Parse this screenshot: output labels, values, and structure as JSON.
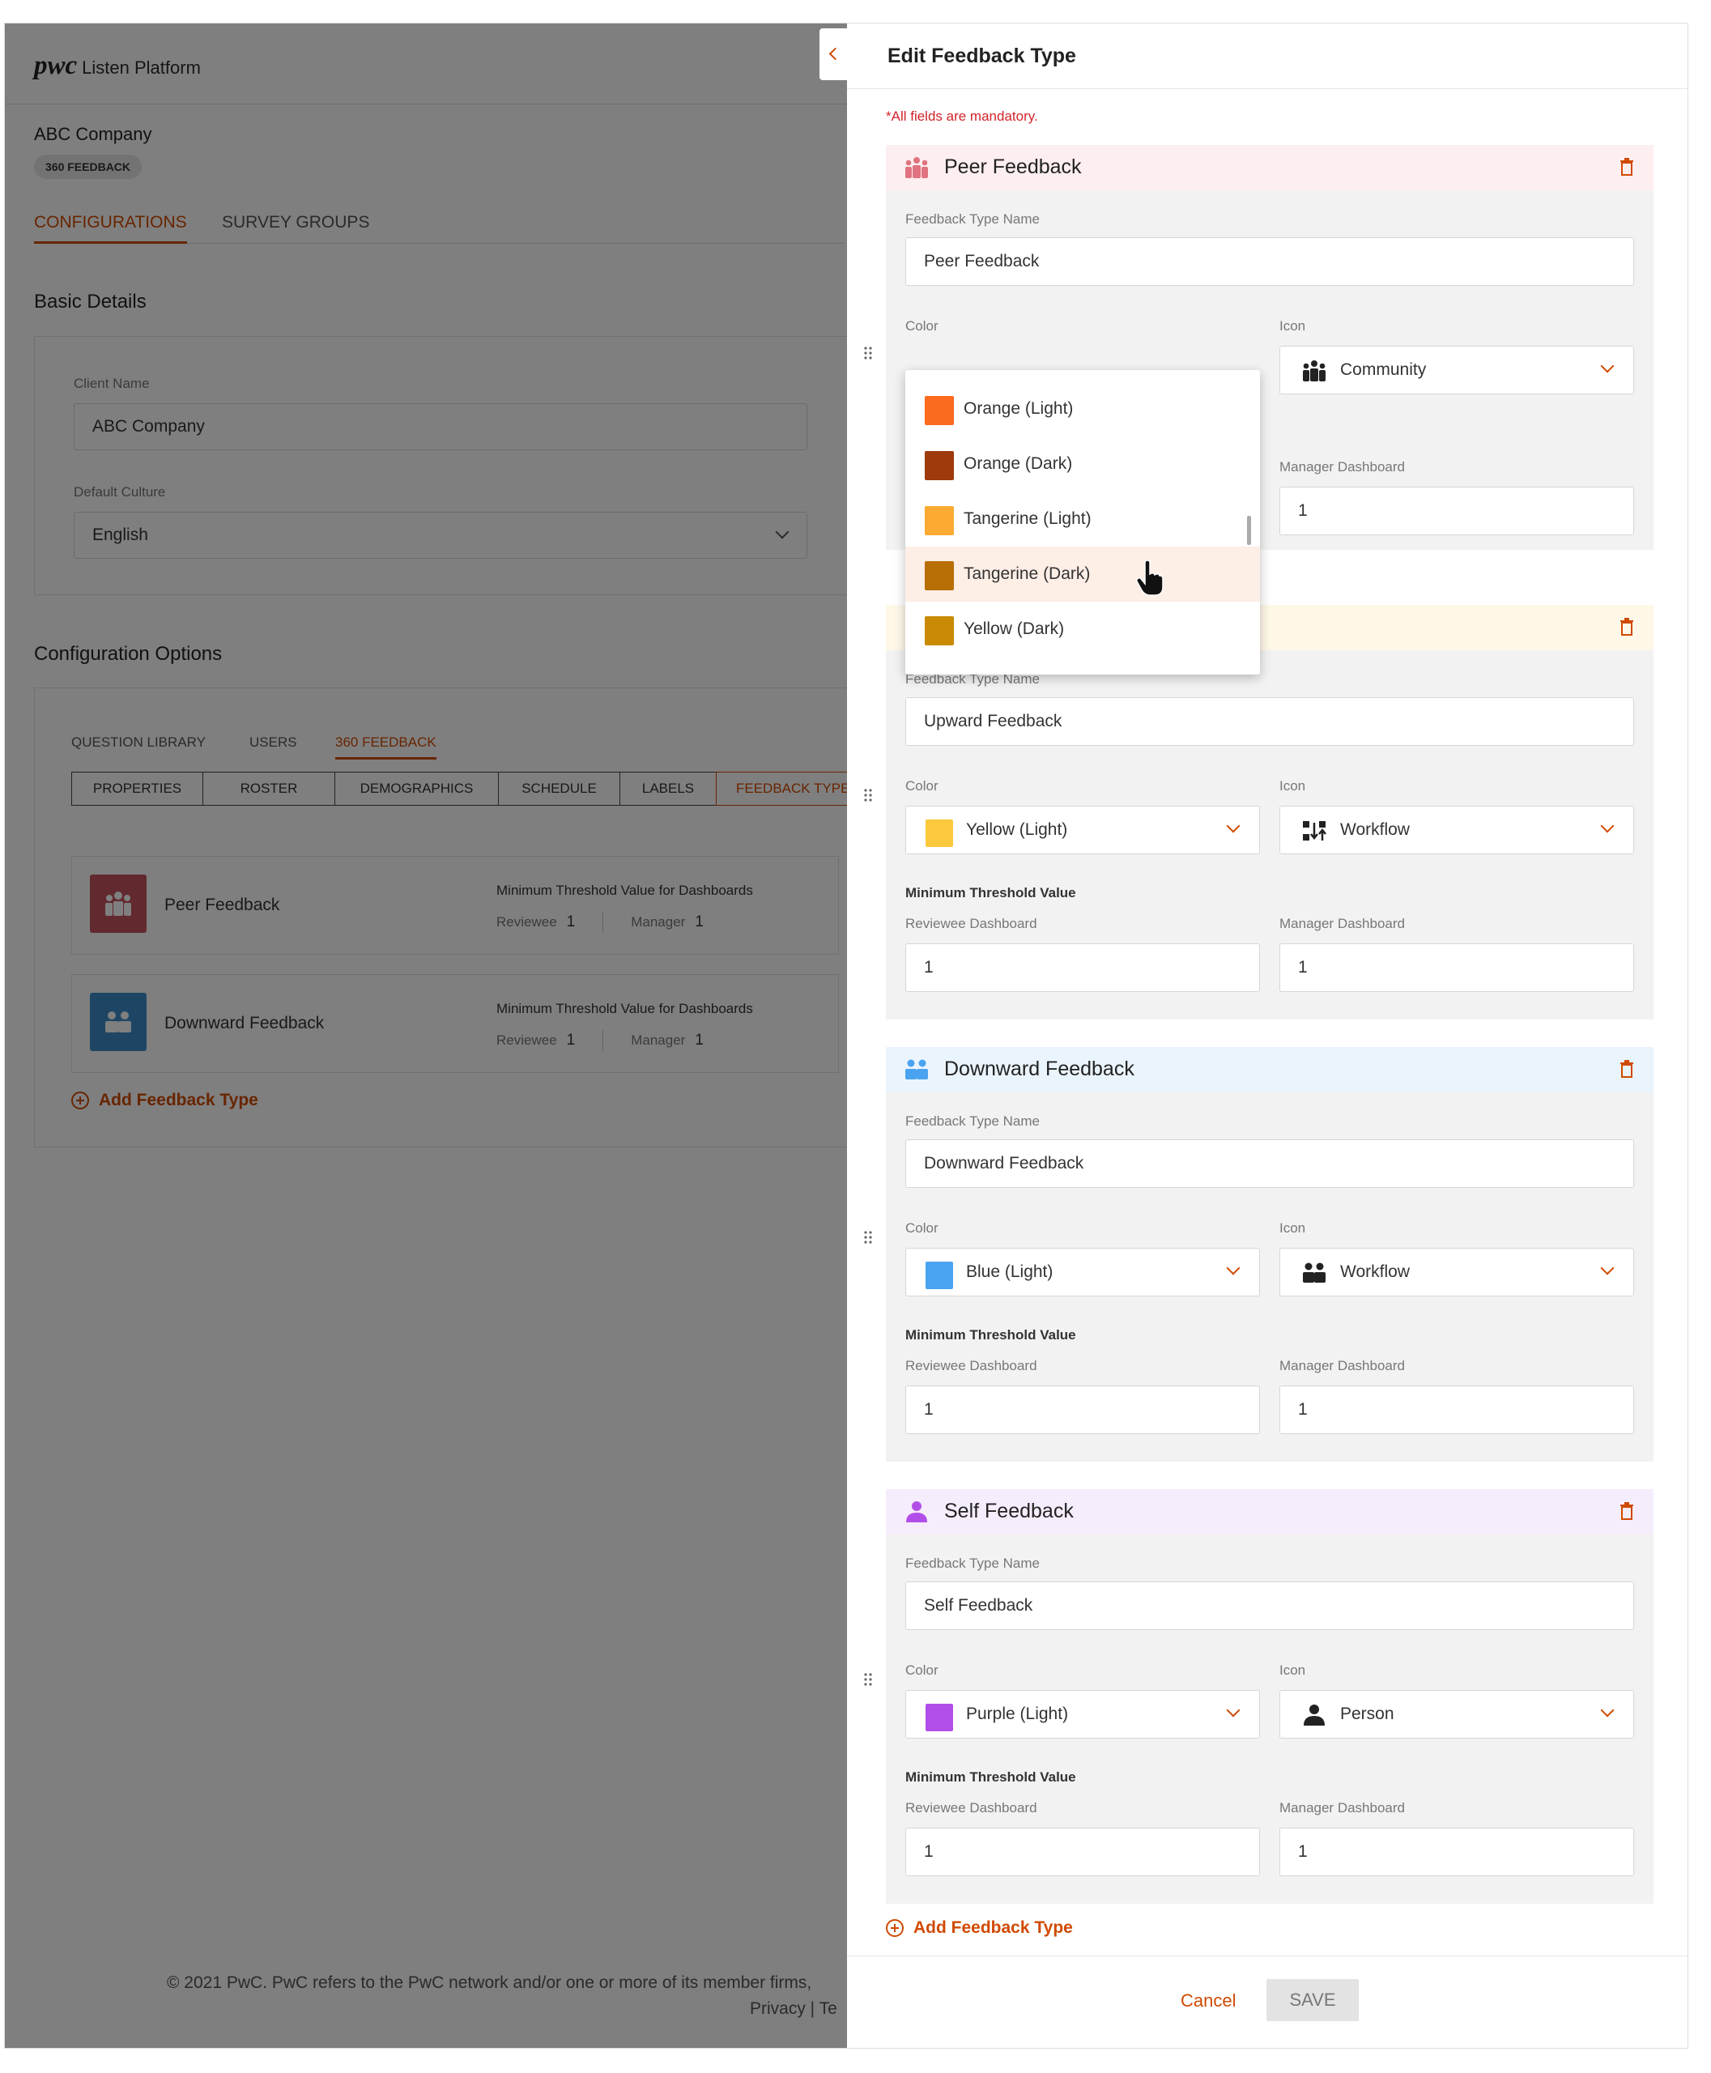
{
  "app": {
    "logo_mark": "pwc",
    "platform": "Listen Platform"
  },
  "client": {
    "company": "ABC Company",
    "badge": "360 FEEDBACK"
  },
  "top_tabs": [
    {
      "label": "CONFIGURATIONS",
      "active": true
    },
    {
      "label": "SURVEY GROUPS",
      "active": false
    }
  ],
  "basic_details": {
    "title": "Basic Details",
    "client_name_label": "Client Name",
    "client_name_value": "ABC Company",
    "culture_label": "Default Culture",
    "culture_value": "English"
  },
  "config": {
    "title": "Configuration Options",
    "sub_tabs": [
      "QUESTION LIBRARY",
      "USERS",
      "360 FEEDBACK"
    ],
    "segments": [
      "PROPERTIES",
      "ROSTER",
      "DEMOGRAPHICS",
      "SCHEDULE",
      "LABELS",
      "FEEDBACK TYPES"
    ],
    "feedback_items": [
      {
        "name": "Peer Feedback",
        "threshold_title": "Minimum Threshold Value for Dashboards",
        "reviewee_label": "Reviewee",
        "reviewee_value": "1",
        "manager_label": "Manager",
        "manager_value": "1",
        "color": "#c4535f"
      },
      {
        "name": "Downward Feedback",
        "threshold_title": "Minimum Threshold Value for Dashboards",
        "reviewee_label": "Reviewee",
        "reviewee_value": "1",
        "manager_label": "Manager",
        "manager_value": "1",
        "color": "#3d8cc9"
      }
    ],
    "add_label": "Add Feedback Type"
  },
  "footer": {
    "line1": "© 2021 PwC. PwC refers to the PwC network and/or one or more of its member firms,",
    "line2": "Privacy |  Te"
  },
  "panel": {
    "title": "Edit Feedback Type",
    "mandatory": "*All fields are mandatory.",
    "name_label": "Feedback Type Name",
    "color_label": "Color",
    "icon_label": "Icon",
    "threshold_label": "Minimum Threshold Value",
    "reviewee_label": "Reviewee Dashboard",
    "manager_label": "Manager Dashboard",
    "blocks": [
      {
        "title": "Peer Feedback",
        "name_value": "Peer Feedback",
        "color": "",
        "swatch": "",
        "icon": "Community",
        "reviewee": "",
        "manager": "1",
        "head_bg": "#fdeef0",
        "accent": "#e0737f"
      },
      {
        "title": "",
        "name_value": "Upward Feedback",
        "color": "Yellow (Light)",
        "swatch": "#fbc93b",
        "icon": "Workflow",
        "reviewee": "1",
        "manager": "1",
        "head_bg": "#fff8e8",
        "accent": "#fbc93b"
      },
      {
        "title": "Downward Feedback",
        "name_value": "Downward Feedback",
        "color": "Blue (Light)",
        "swatch": "#4aa3f0",
        "icon": "Workflow",
        "reviewee": "1",
        "manager": "1",
        "head_bg": "#eaf4fd",
        "accent": "#4aa3f0"
      },
      {
        "title": "Self Feedback",
        "name_value": "Self Feedback",
        "color": "Purple (Light)",
        "swatch": "#b24ee8",
        "icon": "Person",
        "reviewee": "1",
        "manager": "1",
        "head_bg": "#f6edfc",
        "accent": "#b24ee8"
      }
    ],
    "add_label": "Add Feedback Type",
    "cancel": "Cancel",
    "save": "SAVE"
  },
  "color_dropdown": {
    "options": [
      {
        "label": "Orange (Light)",
        "swatch": "#fb6a1e"
      },
      {
        "label": "Orange (Dark)",
        "swatch": "#9e3a0c"
      },
      {
        "label": "Tangerine (Light)",
        "swatch": "#fcaa31"
      },
      {
        "label": "Tangerine (Dark)",
        "swatch": "#b86e05",
        "hover": true
      },
      {
        "label": "Yellow (Dark)",
        "swatch": "#c98b06"
      }
    ]
  },
  "colors": {
    "accent": "#d04a02",
    "error": "#d0232b"
  }
}
